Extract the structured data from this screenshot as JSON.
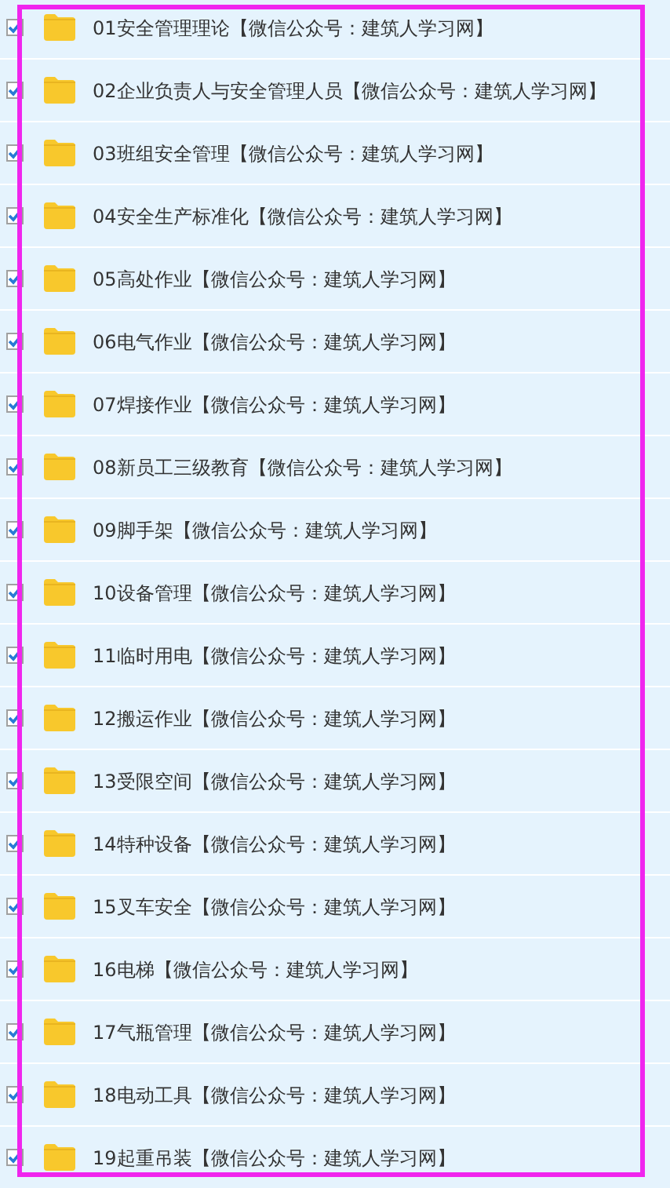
{
  "files": [
    {
      "name": "01安全管理理论【微信公众号：建筑人学习网】",
      "checked": true
    },
    {
      "name": "02企业负责人与安全管理人员【微信公众号：建筑人学习网】",
      "checked": true
    },
    {
      "name": "03班组安全管理【微信公众号：建筑人学习网】",
      "checked": true
    },
    {
      "name": "04安全生产标准化【微信公众号：建筑人学习网】",
      "checked": true
    },
    {
      "name": "05高处作业【微信公众号：建筑人学习网】",
      "checked": true
    },
    {
      "name": "06电气作业【微信公众号：建筑人学习网】",
      "checked": true
    },
    {
      "name": "07焊接作业【微信公众号：建筑人学习网】",
      "checked": true
    },
    {
      "name": "08新员工三级教育【微信公众号：建筑人学习网】",
      "checked": true
    },
    {
      "name": "09脚手架【微信公众号：建筑人学习网】",
      "checked": true
    },
    {
      "name": "10设备管理【微信公众号：建筑人学习网】",
      "checked": true
    },
    {
      "name": "11临时用电【微信公众号：建筑人学习网】",
      "checked": true
    },
    {
      "name": "12搬运作业【微信公众号：建筑人学习网】",
      "checked": true
    },
    {
      "name": "13受限空间【微信公众号：建筑人学习网】",
      "checked": true
    },
    {
      "name": "14特种设备【微信公众号：建筑人学习网】",
      "checked": true
    },
    {
      "name": "15叉车安全【微信公众号：建筑人学习网】",
      "checked": true
    },
    {
      "name": "16电梯【微信公众号：建筑人学习网】",
      "checked": true
    },
    {
      "name": "17气瓶管理【微信公众号：建筑人学习网】",
      "checked": true
    },
    {
      "name": "18电动工具【微信公众号：建筑人学习网】",
      "checked": true
    },
    {
      "name": "19起重吊装【微信公众号：建筑人学习网】",
      "checked": true
    }
  ]
}
